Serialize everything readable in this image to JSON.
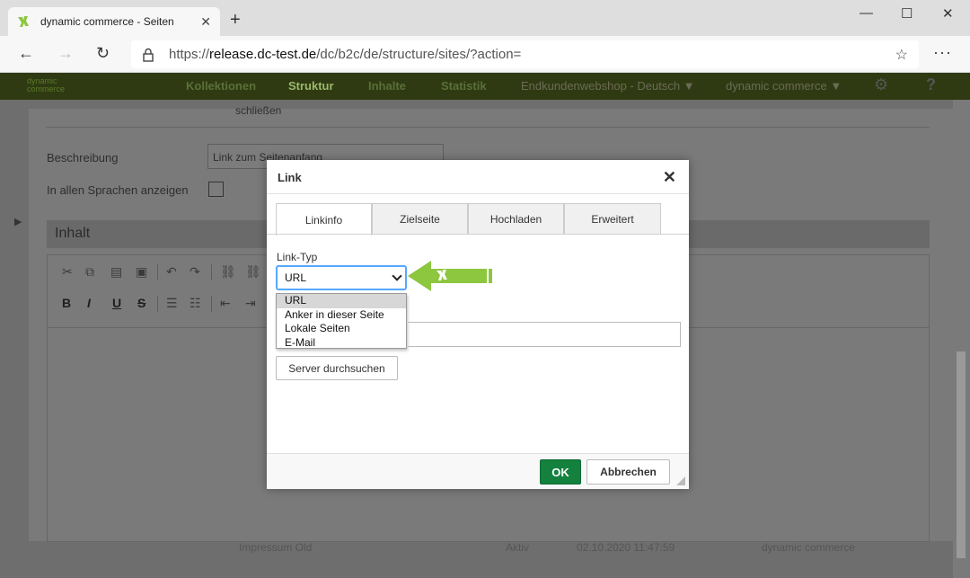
{
  "browser": {
    "tab_title": "dynamic commerce - Seiten",
    "tab_close": "✕",
    "new_tab": "+",
    "minimize": "—",
    "maximize": "☐",
    "close": "✕",
    "back": "←",
    "forward": "→",
    "reload": "↻",
    "url_prefix": "https://",
    "url_domain": "release.dc-test.de",
    "url_path": "/dc/b2c/de/structure/sites/?action=",
    "favorite": "☆",
    "more": "···"
  },
  "app_nav": {
    "logo_line1": "dynamic",
    "logo_line2": "commerce",
    "items": [
      "Kollektionen",
      "Struktur",
      "Inhalte",
      "Statistik"
    ],
    "shop_selector": "Endkundenwebshop - Deutsch",
    "company_selector": "dynamic commerce",
    "settings_icon": "⚙",
    "help_icon": "?"
  },
  "under_modal": {
    "close_text": "schließen",
    "description_label": "Beschreibung",
    "description_value": "Link zum Seitenanfang",
    "all_languages_label": "In allen Sprachen anzeigen",
    "content_section": "Inhalt"
  },
  "background_row": {
    "name": "Impressum Old",
    "status": "Aktiv",
    "date": "02.10.2020 11:47:59",
    "owner": "dynamic commerce"
  },
  "dialog": {
    "title": "Link",
    "close": "✕",
    "tabs": [
      "Linkinfo",
      "Zielseite",
      "Hochladen",
      "Erweitert"
    ],
    "link_type_label": "Link-Typ",
    "link_type_value": "URL",
    "link_type_options": [
      "URL",
      "Anker in dieser Seite",
      "Lokale Seiten",
      "E-Mail"
    ],
    "server_button": "Server durchsuchen",
    "ok_button": "OK",
    "cancel_button": "Abbrechen"
  },
  "colors": {
    "ok_green": "#14813f",
    "annotation_green": "#8dc63f",
    "select_focus": "#56a8ff"
  }
}
